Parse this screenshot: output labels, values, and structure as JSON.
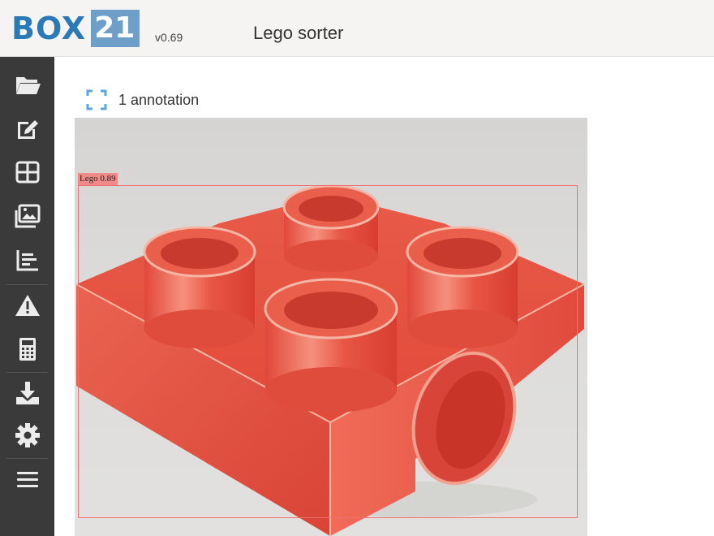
{
  "header": {
    "logo_text": "BOX",
    "logo_number": "21",
    "version": "v0.69",
    "title": "Lego sorter"
  },
  "sidebar": {
    "items": [
      {
        "icon": "folder-open-icon"
      },
      {
        "icon": "edit-icon"
      },
      {
        "icon": "grid-icon"
      },
      {
        "icon": "images-icon"
      },
      {
        "icon": "bar-chart-icon"
      },
      {
        "icon": "warning-icon"
      },
      {
        "icon": "calculator-icon"
      },
      {
        "icon": "download-icon"
      },
      {
        "icon": "gear-icon"
      },
      {
        "icon": "menu-icon"
      }
    ]
  },
  "main": {
    "annotation_count_label": "1 annotation",
    "annotations": [
      {
        "label": "Lego 0.89",
        "color": "#f07070"
      }
    ]
  },
  "colors": {
    "accent": "#2b7ab8",
    "sidebar_bg": "#3a3a3a",
    "annotation_icon": "#5aa7e6",
    "lego_red": "#e8473a"
  }
}
